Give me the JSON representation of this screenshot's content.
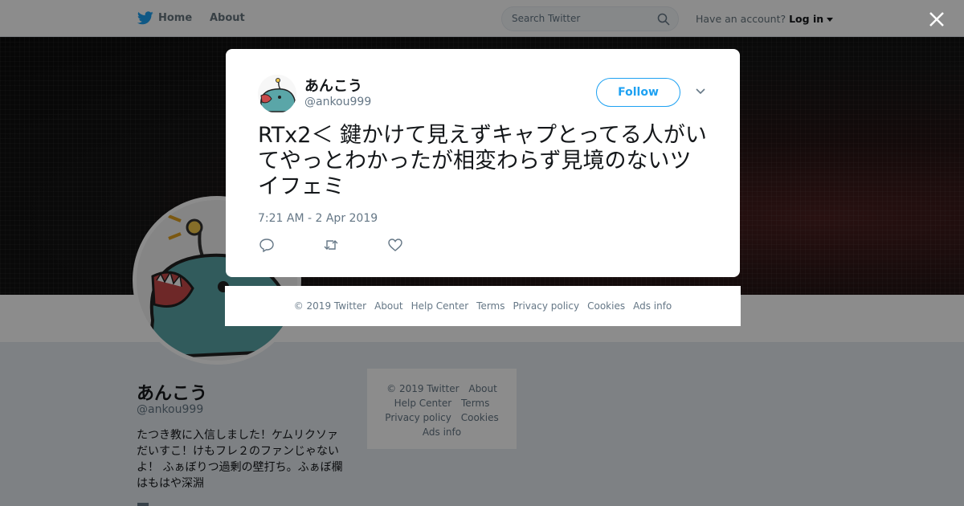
{
  "topbar": {
    "home_label": "Home",
    "about_label": "About",
    "search_placeholder": "Search Twitter",
    "account_prompt": "Have an account?",
    "login_label": "Log in"
  },
  "profile": {
    "name": "あんこう",
    "handle": "@ankou999",
    "bio": "たつき教に入信しました！ケムリクソァだいすこ！けもフレ２のファンじゃないよ！ ふぁぼりつ過剰の壁打ち。ふぁぼ欄はもはや深淵"
  },
  "side_footer": {
    "items": [
      "© 2019 Twitter",
      "About",
      "Help Center",
      "Terms",
      "Privacy policy",
      "Cookies",
      "Ads info"
    ]
  },
  "modal": {
    "name": "あんこう",
    "handle": "@ankou999",
    "follow_label": "Follow",
    "tweet_text": "RTx2＜ 鍵かけて見えずキャプとってる人がいてやっとわかったが相変わらず見境のないツイフェミ",
    "timestamp": "7:21 AM - 2 Apr 2019",
    "actions": [
      "reply-icon",
      "retweet-icon",
      "like-icon"
    ]
  },
  "modal_footer": {
    "items": [
      "© 2019 Twitter",
      "About",
      "Help Center",
      "Terms",
      "Privacy policy",
      "Cookies",
      "Ads info"
    ]
  },
  "colors": {
    "brand": "#1da1f2",
    "text": "#14171a",
    "muted": "#657786",
    "avatar_fish": "#5aa6a8"
  }
}
